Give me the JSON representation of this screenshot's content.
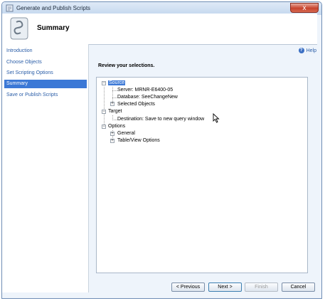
{
  "window": {
    "title": "Generate and Publish Scripts",
    "close_glyph": "x"
  },
  "header": {
    "title": "Summary",
    "icon": "script-scroll-icon"
  },
  "nav": {
    "items": [
      {
        "label": "Introduction",
        "active": false
      },
      {
        "label": "Choose Objects",
        "active": false
      },
      {
        "label": "Set Scripting Options",
        "active": false
      },
      {
        "label": "Summary",
        "active": true
      },
      {
        "label": "Save or Publish Scripts",
        "active": false
      }
    ]
  },
  "help": {
    "label": "Help",
    "icon_glyph": "?"
  },
  "review": {
    "label": "Review your selections."
  },
  "tree": {
    "source": {
      "label": "Source",
      "server": "Server: MRNR-E6400-05",
      "database": "Database: SeeChangeNew",
      "selected_objects": "Selected Objects"
    },
    "target": {
      "label": "Target",
      "destination": "Destination: Save to new query window"
    },
    "options": {
      "label": "Options",
      "general": "General",
      "table_view": "Table/View Options"
    },
    "expand_glyph": "+",
    "collapse_glyph": "−"
  },
  "buttons": {
    "previous": "< Previous",
    "next": "Next >",
    "finish": "Finish",
    "cancel": "Cancel"
  }
}
